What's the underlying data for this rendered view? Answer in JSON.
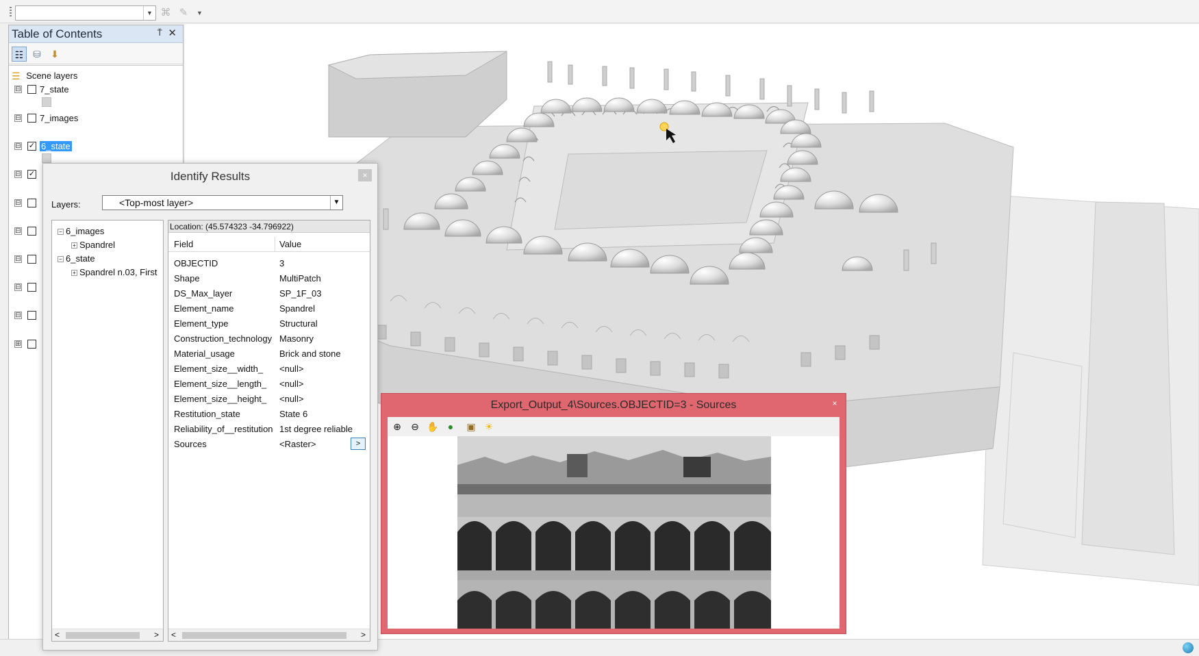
{
  "toolbar": {
    "combo_value": "",
    "icons": [
      "georeferencing-icon",
      "edit-tool-icon",
      "overflow-chevron-icon"
    ]
  },
  "toc": {
    "title": "Table of Contents",
    "pin_glyph": "Ť",
    "close_glyph": "✕",
    "root_label": "Scene layers",
    "layers": [
      {
        "label": "7_state",
        "checked": false,
        "expand": "⊟"
      },
      {
        "label": "7_images",
        "checked": false,
        "expand": "⊟"
      },
      {
        "label": "6_state",
        "checked": true,
        "selected": true,
        "expand": "⊟"
      },
      {
        "label": "",
        "checked": true,
        "expand": "⊟"
      },
      {
        "label": "",
        "checked": false,
        "expand": "⊟"
      },
      {
        "label": "",
        "checked": false,
        "expand": "⊟"
      },
      {
        "label": "",
        "checked": false,
        "expand": "⊟"
      },
      {
        "label": "",
        "checked": false,
        "expand": "⊟"
      },
      {
        "label": "",
        "checked": false,
        "expand": "⊟"
      },
      {
        "label": "",
        "checked": false,
        "expand": "⊞"
      }
    ]
  },
  "identify": {
    "title": "Identify Results",
    "close_glyph": "×",
    "layers_label": "Layers:",
    "layers_value": "<Top-most layer>",
    "tree": [
      {
        "label": "6_images",
        "level": 0,
        "glyph": "−"
      },
      {
        "label": "Spandrel",
        "level": 1,
        "glyph": "+"
      },
      {
        "label": "6_state",
        "level": 0,
        "glyph": "−"
      },
      {
        "label": "Spandrel n.03, First",
        "level": 1,
        "glyph": "+"
      }
    ],
    "location": "Location: (45.574323 -34.796922)",
    "field_header": "Field",
    "value_header": "Value",
    "rows": [
      {
        "field": "OBJECTID",
        "value": "3"
      },
      {
        "field": "Shape",
        "value": "MultiPatch"
      },
      {
        "field": "DS_Max_layer",
        "value": "SP_1F_03"
      },
      {
        "field": "Element_name",
        "value": "Spandrel"
      },
      {
        "field": "Element_type",
        "value": "Structural"
      },
      {
        "field": "Construction_technology",
        "value": "Masonry"
      },
      {
        "field": "Material_usage",
        "value": "Brick and stone"
      },
      {
        "field": "Element_size__width_",
        "value": "<null>"
      },
      {
        "field": "Element_size__length_",
        "value": "<null>"
      },
      {
        "field": "Element_size__height_",
        "value": "<null>"
      },
      {
        "field": "Restitution_state",
        "value": "State 6"
      },
      {
        "field": "Reliability_of__restitution",
        "value": "1st degree reliable"
      },
      {
        "field": "Sources",
        "value": "<Raster>",
        "button": ">"
      }
    ],
    "scroll_left": "<",
    "scroll_right": ">"
  },
  "sources_window": {
    "title": "Export_Output_4\\Sources.OBJECTID=3 - Sources",
    "close_glyph": "×",
    "tools": [
      "zoom-in-icon",
      "zoom-out-icon",
      "pan-hand-icon",
      "full-extent-globe-icon",
      "export-icon",
      "sun-icon"
    ]
  },
  "colors": {
    "toc_title_bg": "#dbe6f4",
    "selection": "#3399ff",
    "sources_frame": "#e0676f",
    "scene_bg": "#ffffff"
  }
}
